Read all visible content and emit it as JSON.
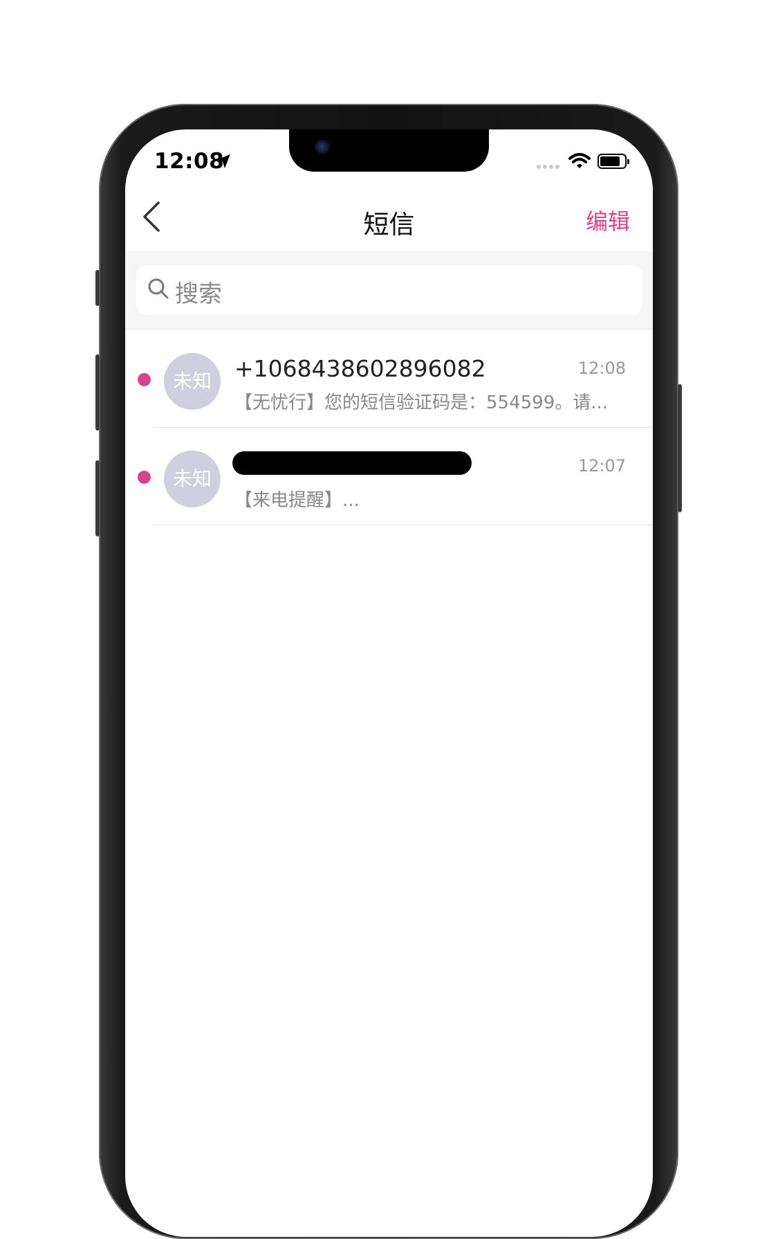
{
  "status_bar": {
    "time": "12:08",
    "icons": [
      "location-arrow-icon",
      "signal-dots-icon",
      "wifi-icon",
      "battery-icon"
    ]
  },
  "nav": {
    "title": "短信",
    "edit_label": "编辑",
    "back_icon": "chevron-left-icon"
  },
  "search": {
    "placeholder": "搜索",
    "icon": "search-icon"
  },
  "conversations": [
    {
      "sender": "+1068438602896082",
      "avatar_text": "未知",
      "time": "12:08",
      "preview": "【无忧行】您的短信验证码是：554599。请...",
      "unread": true,
      "sender_redacted": false
    },
    {
      "sender": "",
      "avatar_text": "未知",
      "time": "12:07",
      "preview": "【来电提醒】...",
      "unread": true,
      "sender_redacted": true
    }
  ],
  "colors": {
    "accent": "#d6458a",
    "avatar_bg": "#cfcfe0",
    "search_area_bg": "#f5f5f5"
  }
}
